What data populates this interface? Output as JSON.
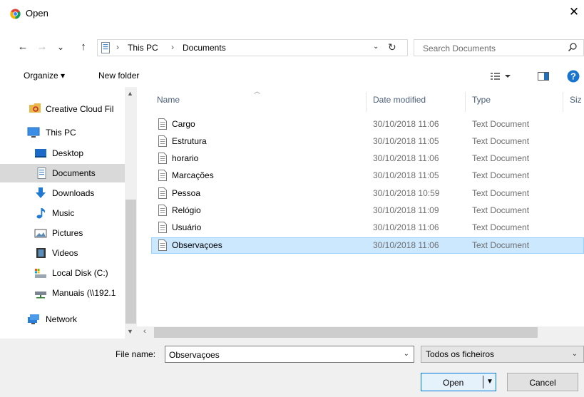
{
  "window": {
    "title": "Open",
    "close_glyph": "✕"
  },
  "nav": {
    "back": "←",
    "forward": "→",
    "recent": "⌄",
    "up": "↑",
    "breadcrumbs": [
      "This PC",
      "Documents"
    ],
    "separator": "›",
    "search_placeholder": "Search Documents"
  },
  "toolbar": {
    "organize": "Organize ▾",
    "new_folder": "New folder"
  },
  "sidebar": {
    "items": [
      {
        "label": "Creative Cloud Fil",
        "icon": "creative-cloud-icon"
      },
      {
        "label": "This PC",
        "icon": "computer-icon"
      },
      {
        "label": "Desktop",
        "icon": "desktop-icon"
      },
      {
        "label": "Documents",
        "icon": "documents-icon",
        "selected": true
      },
      {
        "label": "Downloads",
        "icon": "download-icon"
      },
      {
        "label": "Music",
        "icon": "music-icon"
      },
      {
        "label": "Pictures",
        "icon": "pictures-icon"
      },
      {
        "label": "Videos",
        "icon": "videos-icon"
      },
      {
        "label": "Local Disk (C:)",
        "icon": "disk-icon"
      },
      {
        "label": "Manuais (\\\\192.1",
        "icon": "network-drive-icon"
      },
      {
        "label": "Network",
        "icon": "network-icon"
      }
    ]
  },
  "files": {
    "columns": [
      "Name",
      "Date modified",
      "Type",
      "Siz"
    ],
    "rows": [
      {
        "name": "Cargo",
        "date": "30/10/2018 11:06",
        "type": "Text Document"
      },
      {
        "name": "Estrutura",
        "date": "30/10/2018 11:05",
        "type": "Text Document"
      },
      {
        "name": "horario",
        "date": "30/10/2018 11:06",
        "type": "Text Document"
      },
      {
        "name": "Marcações",
        "date": "30/10/2018 11:05",
        "type": "Text Document"
      },
      {
        "name": "Pessoa",
        "date": "30/10/2018 10:59",
        "type": "Text Document"
      },
      {
        "name": "Relógio",
        "date": "30/10/2018 11:09",
        "type": "Text Document"
      },
      {
        "name": "Usuário",
        "date": "30/10/2018 11:06",
        "type": "Text Document"
      },
      {
        "name": "Observaçoes",
        "date": "30/10/2018 11:06",
        "type": "Text Document",
        "selected": true
      }
    ]
  },
  "bottom": {
    "file_name_label": "File name:",
    "file_name_value": "Observaçoes",
    "filter_value": "Todos os ficheiros",
    "open_label": "Open",
    "cancel_label": "Cancel"
  },
  "colors": {
    "accent": "#0078d7",
    "selection": "#cce8ff",
    "nav_selected": "#d9d9d9"
  }
}
